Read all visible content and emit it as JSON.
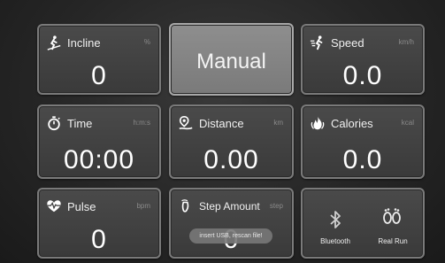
{
  "tiles": {
    "incline": {
      "label": "Incline",
      "unit": "%",
      "value": "0",
      "icon": "incline-runner-icon"
    },
    "mode": {
      "label": "Manual"
    },
    "speed": {
      "label": "Speed",
      "unit": "km/h",
      "value": "0.0",
      "icon": "speed-runner-icon"
    },
    "time": {
      "label": "Time",
      "unit": "h:m:s",
      "value": "00:00",
      "icon": "stopwatch-icon"
    },
    "distance": {
      "label": "Distance",
      "unit": "km",
      "value": "0.00",
      "icon": "distance-icon"
    },
    "calories": {
      "label": "Calories",
      "unit": "kcal",
      "value": "0.0",
      "icon": "flame-icon"
    },
    "pulse": {
      "label": "Pulse",
      "unit": "bpm",
      "value": "0",
      "icon": "heart-pulse-icon"
    },
    "step": {
      "label": "Step Amount",
      "unit": "step",
      "value": "0",
      "icon": "step-icon"
    },
    "connect": {
      "bluetooth_label": "Bluetooth",
      "realrun_label": "Real Run",
      "bluetooth_icon": "bluetooth-icon",
      "realrun_icon": "footprints-icon"
    }
  },
  "toast": {
    "text": "insert USB, rescan file!"
  }
}
